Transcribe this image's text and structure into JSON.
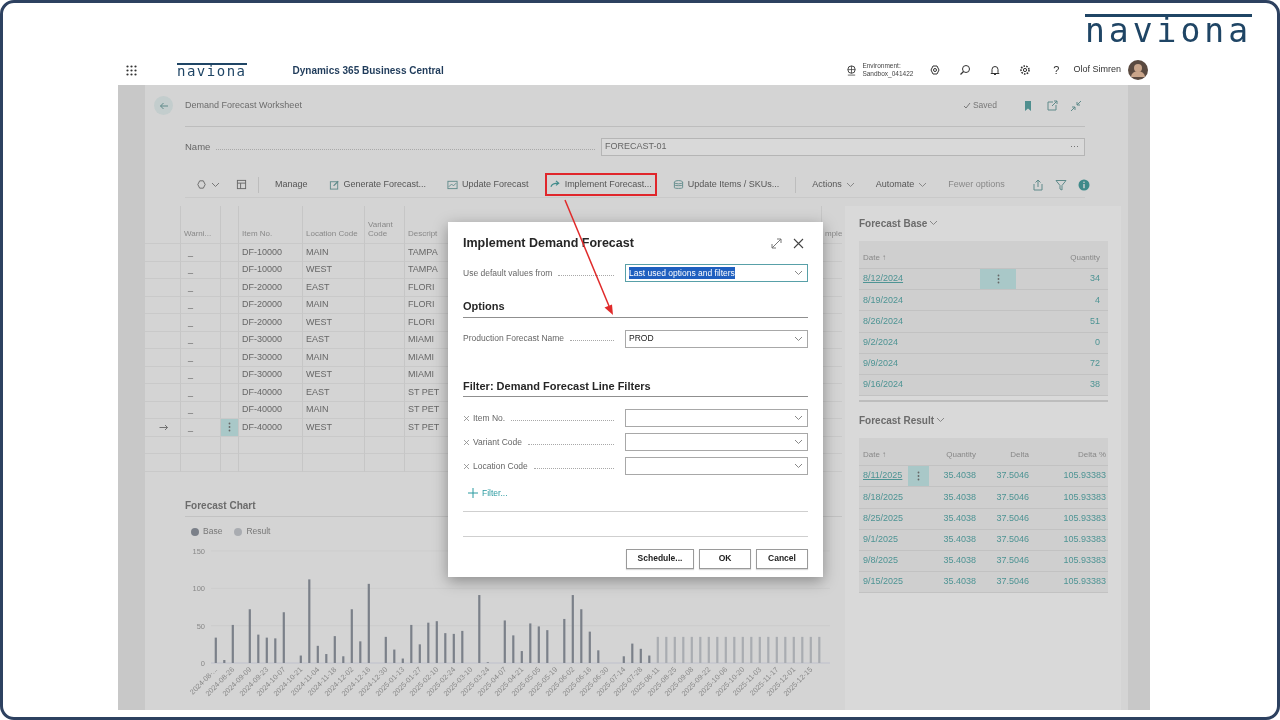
{
  "brand_logo": "naviona",
  "app_header": {
    "logo": "naviona",
    "product": "Dynamics 365 Business Central",
    "environment_label": "Environment:",
    "environment_name": "Sandbox_041422",
    "help": "?",
    "user_name": "Olof Simren"
  },
  "page": {
    "title": "Demand Forecast Worksheet",
    "status": "Saved",
    "name_label": "Name",
    "name_value": "FORECAST-01",
    "name_menu": "···"
  },
  "toolbar": [
    {
      "label": "Manage",
      "kind": "plain",
      "divider_before": true,
      "highlighted": false
    },
    {
      "label": "Generate Forecast...",
      "kind": "generate",
      "divider_before": false,
      "highlighted": false
    },
    {
      "label": "Update Forecast",
      "kind": "chart",
      "divider_before": false,
      "highlighted": false
    },
    {
      "label": "Implement Forecast...",
      "kind": "forward",
      "divider_before": false,
      "highlighted": true
    },
    {
      "label": "Update Items / SKUs...",
      "kind": "database",
      "divider_before": false,
      "highlighted": false
    },
    {
      "label": "Actions",
      "kind": "menu",
      "divider_before": true,
      "highlighted": false
    },
    {
      "label": "Automate",
      "kind": "menu",
      "divider_before": false,
      "highlighted": false
    },
    {
      "label": "Fewer options",
      "kind": "plain",
      "divider_before": false,
      "highlighted": false
    }
  ],
  "worksheet_table": {
    "columns": [
      "Warni...",
      "Item No.",
      "Location Code",
      "Variant Code",
      "Descript",
      "mple"
    ],
    "rows": [
      {
        "current": false,
        "selected": false,
        "warning": "_",
        "item_no": "DF-10000",
        "location_code": "MAIN",
        "description": "TAMPA"
      },
      {
        "current": false,
        "selected": false,
        "warning": "_",
        "item_no": "DF-10000",
        "location_code": "WEST",
        "description": "TAMPA"
      },
      {
        "current": false,
        "selected": false,
        "warning": "_",
        "item_no": "DF-20000",
        "location_code": "EAST",
        "description": "FLORI"
      },
      {
        "current": false,
        "selected": false,
        "warning": "_",
        "item_no": "DF-20000",
        "location_code": "MAIN",
        "description": "FLORI"
      },
      {
        "current": false,
        "selected": false,
        "warning": "_",
        "item_no": "DF-20000",
        "location_code": "WEST",
        "description": "FLORI"
      },
      {
        "current": false,
        "selected": false,
        "warning": "_",
        "item_no": "DF-30000",
        "location_code": "EAST",
        "description": "MIAMI"
      },
      {
        "current": false,
        "selected": false,
        "warning": "_",
        "item_no": "DF-30000",
        "location_code": "MAIN",
        "description": "MIAMI"
      },
      {
        "current": false,
        "selected": false,
        "warning": "_",
        "item_no": "DF-30000",
        "location_code": "WEST",
        "description": "MIAMI"
      },
      {
        "current": false,
        "selected": false,
        "warning": "_",
        "item_no": "DF-40000",
        "location_code": "EAST",
        "description": "ST PET"
      },
      {
        "current": false,
        "selected": false,
        "warning": "_",
        "item_no": "DF-40000",
        "location_code": "MAIN",
        "description": "ST PET"
      },
      {
        "current": true,
        "selected": true,
        "warning": "_",
        "item_no": "DF-40000",
        "location_code": "WEST",
        "description": "ST PET"
      }
    ]
  },
  "forecast_chart": {
    "chart_data": {
      "type": "bar",
      "title": "Forecast Chart",
      "ylim": [
        0,
        150
      ],
      "yticks": [
        0,
        50,
        100,
        150
      ],
      "categories": [
        "2024-08-...",
        null,
        "2024-08-26",
        null,
        "2024-09-09",
        null,
        "2024-09-23",
        null,
        "2024-10-07",
        null,
        "2024-10-21",
        null,
        "2024-11-04",
        null,
        "2024-11-18",
        null,
        "2024-12-02",
        null,
        "2024-12-16",
        null,
        "2024-12-30",
        null,
        "2025-01-13",
        null,
        "2025-01-27",
        null,
        "2025-02-10",
        null,
        "2025-02-24",
        null,
        "2025-03-10",
        null,
        "2025-03-24",
        null,
        "2025-04-07",
        null,
        "2025-04-21",
        null,
        "2025-05-05",
        null,
        "2025-05-19",
        null,
        "2025-06-02",
        null,
        "2025-06-16",
        null,
        "2025-06-30",
        null,
        "2025-07-14",
        null,
        "2025-07-28",
        null,
        "2025-08-11",
        null,
        "2025-08-25",
        null,
        "2025-09-08",
        null,
        "2025-09-22",
        null,
        "2025-10-06",
        null,
        "2025-10-20",
        null,
        "2025-11-03",
        null,
        "2025-11-17",
        null,
        "2025-12-01",
        null,
        "2025-12-15",
        null
      ],
      "series": [
        {
          "name": "Base",
          "color": "#7b8089",
          "values": [
            34,
            4,
            51,
            0,
            72,
            38,
            34,
            33,
            68,
            0,
            10,
            112,
            23,
            12,
            36,
            9,
            72,
            29,
            106,
            0,
            35,
            18,
            6,
            51,
            25,
            54,
            56,
            40,
            39,
            43,
            0,
            91,
            1,
            0,
            57,
            37,
            16,
            53,
            49,
            44,
            0,
            59,
            91,
            72,
            42,
            17,
            0,
            0,
            9,
            26,
            19,
            10,
            null,
            null,
            null,
            null,
            null,
            null,
            null,
            null,
            null,
            null,
            null,
            null,
            null,
            null,
            null,
            null,
            null,
            null,
            null,
            null
          ]
        },
        {
          "name": "Result",
          "color": "#a9acb1",
          "values": [
            null,
            null,
            null,
            null,
            null,
            null,
            null,
            null,
            null,
            null,
            null,
            null,
            null,
            null,
            null,
            null,
            null,
            null,
            null,
            null,
            null,
            null,
            null,
            null,
            null,
            null,
            null,
            null,
            null,
            null,
            null,
            null,
            null,
            null,
            null,
            null,
            null,
            null,
            null,
            null,
            null,
            null,
            null,
            null,
            null,
            null,
            null,
            null,
            null,
            null,
            null,
            null,
            35,
            35,
            35,
            35,
            35,
            35,
            35,
            35,
            35,
            35,
            35,
            35,
            35,
            35,
            35,
            35,
            35,
            35,
            35,
            35
          ]
        }
      ]
    }
  },
  "forecast_base": {
    "title": "Forecast Base",
    "columns": [
      "Date ↑",
      "Quantity"
    ],
    "rows": [
      {
        "date": "8/12/2024",
        "quantity": "34",
        "selected": true
      },
      {
        "date": "8/19/2024",
        "quantity": "4",
        "selected": false
      },
      {
        "date": "8/26/2024",
        "quantity": "51",
        "selected": false
      },
      {
        "date": "9/2/2024",
        "quantity": "0",
        "selected": false
      },
      {
        "date": "9/9/2024",
        "quantity": "72",
        "selected": false
      },
      {
        "date": "9/16/2024",
        "quantity": "38",
        "selected": false
      }
    ]
  },
  "forecast_result": {
    "title": "Forecast Result",
    "columns": [
      "Date ↑",
      "Quantity",
      "Delta",
      "Delta %"
    ],
    "rows": [
      {
        "date": "8/11/2025",
        "quantity": "35.4038",
        "delta": "37.5046",
        "delta_pct": "105.93383",
        "selected": true
      },
      {
        "date": "8/18/2025",
        "quantity": "35.4038",
        "delta": "37.5046",
        "delta_pct": "105.93383",
        "selected": false
      },
      {
        "date": "8/25/2025",
        "quantity": "35.4038",
        "delta": "37.5046",
        "delta_pct": "105.93383",
        "selected": false
      },
      {
        "date": "9/1/2025",
        "quantity": "35.4038",
        "delta": "37.5046",
        "delta_pct": "105.93383",
        "selected": false
      },
      {
        "date": "9/8/2025",
        "quantity": "35.4038",
        "delta": "37.5046",
        "delta_pct": "105.93383",
        "selected": false
      },
      {
        "date": "9/15/2025",
        "quantity": "35.4038",
        "delta": "37.5046",
        "delta_pct": "105.93383",
        "selected": false
      }
    ]
  },
  "dialog": {
    "title": "Implement Demand Forecast",
    "default_field": {
      "label": "Use default values from",
      "value": "Last used options and filters",
      "text_selected": true
    },
    "options": {
      "heading": "Options",
      "fields": [
        {
          "label": "Production Forecast Name",
          "value": "PROD"
        }
      ]
    },
    "filters": {
      "heading": "Filter: Demand Forecast Line Filters",
      "items": [
        {
          "label": "Item No."
        },
        {
          "label": "Variant Code"
        },
        {
          "label": "Location Code"
        }
      ],
      "add_filter": "Filter..."
    },
    "buttons": [
      "Schedule...",
      "OK",
      "Cancel"
    ]
  }
}
